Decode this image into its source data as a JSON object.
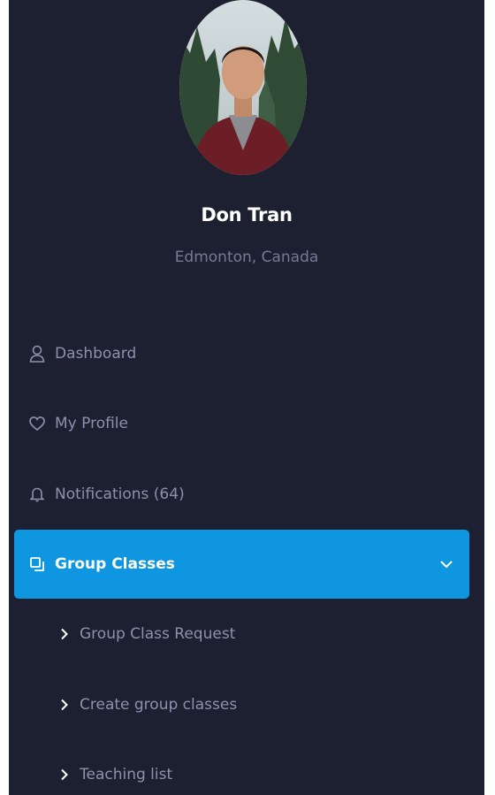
{
  "profile": {
    "name": "Don Tran",
    "location": "Edmonton, Canada"
  },
  "nav": {
    "items": [
      {
        "label": "Dashboard",
        "icon": "user-icon"
      },
      {
        "label": "My Profile",
        "icon": "heart-icon"
      },
      {
        "label": "Notifications (64)",
        "icon": "bell-icon"
      },
      {
        "label": "Group Classes",
        "icon": "copy-icon",
        "active": true
      }
    ],
    "sub_items": [
      {
        "label": "Group Class Request",
        "icon": "chevron-right-icon"
      },
      {
        "label": "Create group classes",
        "icon": "chevron-right-icon"
      },
      {
        "label": "Teaching list",
        "icon": "chevron-right-icon"
      }
    ]
  },
  "colors": {
    "sidebar_bg": "#1d2031",
    "accent": "#0f96e0",
    "muted_text": "#8d92ab",
    "name_text": "#ffffff"
  }
}
